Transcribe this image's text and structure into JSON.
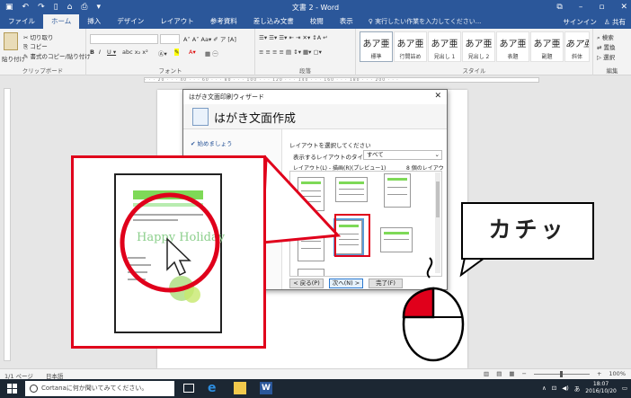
{
  "titlebar": {
    "document_title": "文書 2 - Word",
    "quick_access": [
      "save-icon",
      "undo-icon",
      "redo-icon"
    ]
  },
  "ribbon_tabs": [
    "ファイル",
    "ホーム",
    "挿入",
    "デザイン",
    "レイアウト",
    "参考資料",
    "差し込み文書",
    "校閲",
    "表示"
  ],
  "active_tab": "ホーム",
  "tell_me": "実行したい作業を入力してください...",
  "account": {
    "signin": "サインイン",
    "share": "共有"
  },
  "ribbon": {
    "clipboard": {
      "paste": "貼り付け",
      "cut": "切り取り",
      "copy": "コピー",
      "format_painter": "書式のコピー/貼り付け",
      "label": "クリップボード"
    },
    "font": {
      "label": "フォント"
    },
    "paragraph": {
      "label": "段落"
    },
    "styles": {
      "label": "スタイル",
      "items": [
        {
          "sample": "あア亜",
          "name": "標準"
        },
        {
          "sample": "あア亜",
          "name": "行間詰め"
        },
        {
          "sample": "あア亜",
          "name": "見出し 1"
        },
        {
          "sample": "あア亜",
          "name": "見出し 2"
        },
        {
          "sample": "あア亜",
          "name": "表題"
        },
        {
          "sample": "あア亜",
          "name": "副題"
        },
        {
          "sample": "あア亜",
          "name": "斜体"
        }
      ]
    },
    "editing": {
      "find": "検索",
      "replace": "置換",
      "select": "選択",
      "label": "編集"
    }
  },
  "wizard": {
    "title": "はがき文面印刷ウィザード",
    "header": "はがき文面作成",
    "step": "始めましょう",
    "prompt": "レイアウトを選択してください",
    "layout_type_label": "表示するレイアウトのタイプ(T):",
    "layout_type_value": "すべて",
    "layout_list_label": "レイアウト(L) - 描画(R)(プレビュー1)",
    "layout_count": "8 個のレイアウト",
    "buttons": {
      "back": "< 戻る(P)",
      "next": "次へ(N) >",
      "finish": "完了(F)"
    }
  },
  "callout_text": "カチッ",
  "statusbar": {
    "page": "1/1 ページ",
    "language": "日本語",
    "zoom": "100%"
  },
  "taskbar": {
    "cortana": "Cortanaに何か聞いてみてください。",
    "time": "18:07",
    "date": "2016/10/20",
    "ime": "あ"
  },
  "colors": {
    "word_blue": "#2b579a",
    "callout_red": "#e0001b",
    "mouse_button_red": "#e0001b",
    "template_green": "#7ed957"
  }
}
